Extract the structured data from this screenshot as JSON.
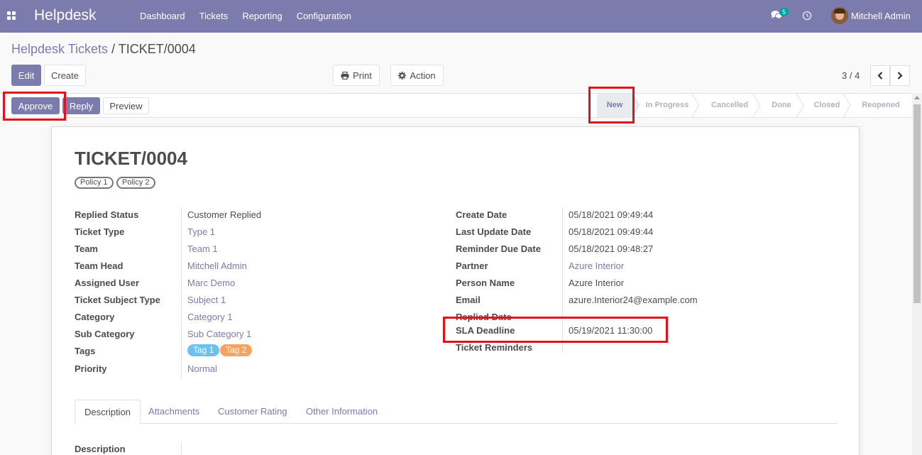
{
  "navbar": {
    "brand": "Helpdesk",
    "menu": [
      "Dashboard",
      "Tickets",
      "Reporting",
      "Configuration"
    ],
    "chat_count": "5",
    "user": "Mitchell Admin",
    "icons": [
      "apps-icon",
      "chat-icon",
      "clock-icon"
    ]
  },
  "breadcrumb": {
    "parent": "Helpdesk Tickets",
    "separator": " / ",
    "current": "TICKET/0004"
  },
  "toolbar": {
    "edit": "Edit",
    "create": "Create",
    "print": "Print",
    "action": "Action",
    "pager": "3 / 4"
  },
  "header_buttons": {
    "approve": "Approve",
    "reply": "Reply",
    "preview": "Preview"
  },
  "stages": [
    "New",
    "In Progress",
    "Cancelled",
    "Done",
    "Closed",
    "Reopened"
  ],
  "active_stage": "New",
  "record": {
    "title": "TICKET/0004",
    "policies": [
      "Policy 1",
      "Policy 2"
    ],
    "left_fields": [
      {
        "label": "Replied Status",
        "value": "Customer Replied"
      },
      {
        "label": "Ticket Type",
        "value": "Type 1"
      },
      {
        "label": "Team",
        "value": "Team 1"
      },
      {
        "label": "Team Head",
        "value": "Mitchell Admin"
      },
      {
        "label": "Assigned User",
        "value": "Marc Demo"
      },
      {
        "label": "Ticket Subject Type",
        "value": "Subject 1"
      },
      {
        "label": "Category",
        "value": "Category 1"
      },
      {
        "label": "Sub Category",
        "value": "Sub Category 1"
      },
      {
        "label": "Tags",
        "value": ""
      },
      {
        "label": "Priority",
        "value": "Normal"
      }
    ],
    "tags": [
      "Tag 1",
      "Tag 2"
    ],
    "right_fields": [
      {
        "label": "Create Date",
        "value": "05/18/2021 09:49:44"
      },
      {
        "label": "Last Update Date",
        "value": "05/18/2021 09:49:44"
      },
      {
        "label": "Reminder Due Date",
        "value": "05/18/2021 09:48:27"
      },
      {
        "label": "Partner",
        "value": "Azure Interior"
      },
      {
        "label": "Person Name",
        "value": "Azure Interior"
      },
      {
        "label": "Email",
        "value": "azure.Interior24@example.com"
      },
      {
        "label": "Replied Date",
        "value": ""
      },
      {
        "label": "SLA Deadline",
        "value": "05/19/2021 11:30:00"
      },
      {
        "label": "Ticket Reminders",
        "value": ""
      }
    ]
  },
  "tabs": [
    "Description",
    "Attachments",
    "Customer Rating",
    "Other Information"
  ],
  "description_label": "Description",
  "colors": {
    "brand": "#7c7bad",
    "tag1": "#6cc1ed",
    "tag2": "#f4a460",
    "highlight": "#e2111b"
  }
}
